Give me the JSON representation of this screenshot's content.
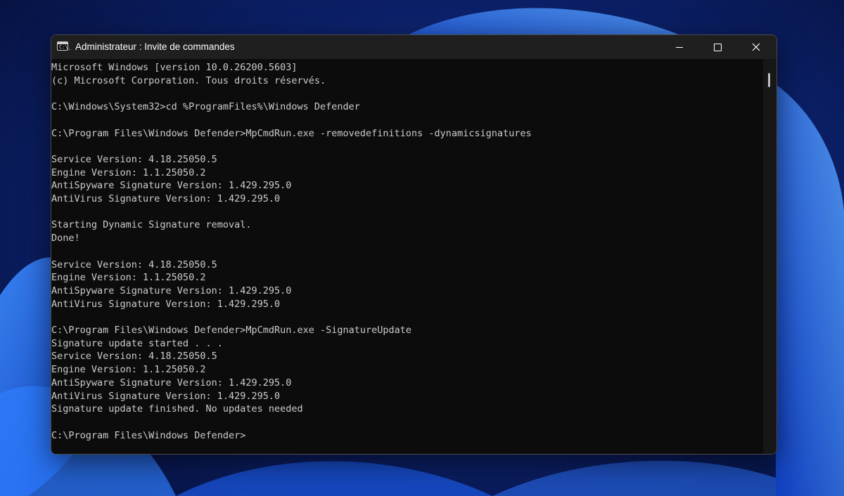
{
  "window": {
    "title": "Administrateur : Invite de commandes",
    "icon": "command-prompt-icon"
  },
  "caption_buttons": {
    "minimize": "minimize-icon",
    "maximize": "maximize-icon",
    "close": "close-icon"
  },
  "console": {
    "lines": [
      "Microsoft Windows [version 10.0.26200.5603]",
      "(c) Microsoft Corporation. Tous droits réservés.",
      "",
      "C:\\Windows\\System32>cd %ProgramFiles%\\Windows Defender",
      "",
      "C:\\Program Files\\Windows Defender>MpCmdRun.exe -removedefinitions -dynamicsignatures",
      "",
      "Service Version: 4.18.25050.5",
      "Engine Version: 1.1.25050.2",
      "AntiSpyware Signature Version: 1.429.295.0",
      "AntiVirus Signature Version: 1.429.295.0",
      "",
      "Starting Dynamic Signature removal.",
      "Done!",
      "",
      "Service Version: 4.18.25050.5",
      "Engine Version: 1.1.25050.2",
      "AntiSpyware Signature Version: 1.429.295.0",
      "AntiVirus Signature Version: 1.429.295.0",
      "",
      "C:\\Program Files\\Windows Defender>MpCmdRun.exe -SignatureUpdate",
      "Signature update started . . .",
      "Service Version: 4.18.25050.5",
      "Engine Version: 1.1.25050.2",
      "AntiSpyware Signature Version: 1.429.295.0",
      "AntiVirus Signature Version: 1.429.295.0",
      "Signature update finished. No updates needed",
      "",
      "C:\\Program Files\\Windows Defender>"
    ]
  },
  "colors": {
    "console_background": "#0c0c0c",
    "console_text": "#cccccc",
    "titlebar": "#1f1f1f",
    "wallpaper_accent": "#1e6cf0"
  }
}
